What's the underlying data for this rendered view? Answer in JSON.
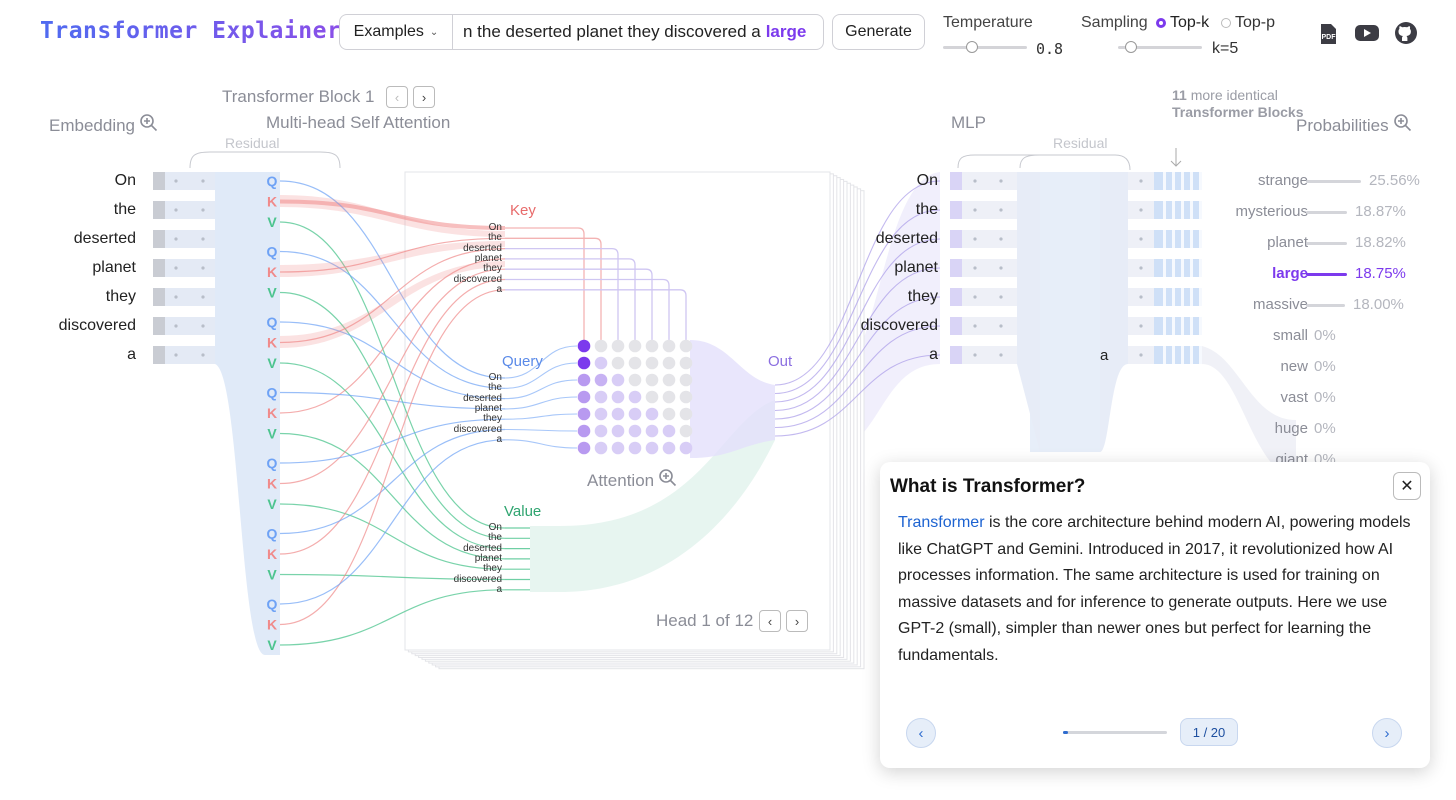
{
  "app": {
    "title": "Transformer Explainer"
  },
  "toolbar": {
    "examples_label": "Examples",
    "prompt_text": "n the deserted planet they discovered a",
    "predicted_token": "large",
    "generate_label": "Generate",
    "temperature_label": "Temperature",
    "temperature_value": "0.8",
    "temperature_level": 0.35,
    "sampling_label": "Sampling",
    "sampling_options": [
      "Top-k",
      "Top-p"
    ],
    "sampling_selected": "Top-k",
    "k_value": "k=5",
    "k_level": 0.15
  },
  "icons": [
    "pdf-icon",
    "youtube-icon",
    "github-icon"
  ],
  "viz": {
    "embedding_label": "Embedding",
    "block_title": "Transformer Block 1",
    "mhsa_label": "Multi-head Self Attention",
    "residual_label": "Residual",
    "mlp_label": "MLP",
    "more_blocks_count": "11",
    "more_blocks_text": "more identical",
    "more_blocks_title": "Transformer Blocks",
    "probabilities_label": "Probabilities",
    "key_label": "Key",
    "query_label": "Query",
    "value_label": "Value",
    "out_label": "Out",
    "attention_label": "Attention",
    "head_label": "Head 1 of 12",
    "qkv_letters": [
      "Q",
      "K",
      "V"
    ],
    "tokens": [
      "On",
      "the",
      "deserted",
      "planet",
      "they",
      "discovered",
      "a"
    ],
    "last_token": "a"
  },
  "probabilities": [
    {
      "token": "strange",
      "value": "25.56%",
      "fraction": 0.2556
    },
    {
      "token": "mysterious",
      "value": "18.87%",
      "fraction": 0.1887
    },
    {
      "token": "planet",
      "value": "18.82%",
      "fraction": 0.1882
    },
    {
      "token": "large",
      "value": "18.75%",
      "fraction": 0.1875
    },
    {
      "token": "massive",
      "value": "18.00%",
      "fraction": 0.18
    },
    {
      "token": "small",
      "value": "0%",
      "fraction": 0
    },
    {
      "token": "new",
      "value": "0%",
      "fraction": 0
    },
    {
      "token": "vast",
      "value": "0%",
      "fraction": 0
    },
    {
      "token": "huge",
      "value": "0%",
      "fraction": 0
    },
    {
      "token": "giant",
      "value": "0%",
      "fraction": 0
    }
  ],
  "selected_probability": "large",
  "popup": {
    "title": "What is Transformer?",
    "body_highlight": "Transformer",
    "body_rest": " is the core architecture behind modern AI, powering models like ChatGPT and Gemini. Introduced in 2017, it revolutionized how AI processes information. The same architecture is used for training on massive datasets and for inference to generate outputs. Here we use GPT-2 (small), simpler than newer ones but perfect for learning the fundamentals.",
    "page": "1 / 20",
    "progress": 0.05
  },
  "colors": {
    "accent": "#7c3aed",
    "query": "#6ea2f5",
    "key": "#f08a8a",
    "value": "#4cc48e",
    "link_blue": "#1d63d1"
  }
}
